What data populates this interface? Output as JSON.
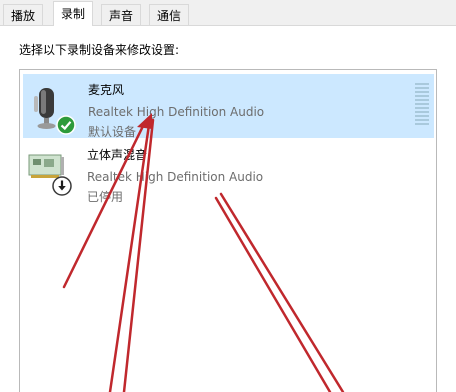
{
  "tabs": [
    {
      "label": "播放",
      "active": false
    },
    {
      "label": "录制",
      "active": true
    },
    {
      "label": "声音",
      "active": false
    },
    {
      "label": "通信",
      "active": false
    }
  ],
  "prompt": "选择以下录制设备来修改设置:",
  "devices": [
    {
      "name": "麦克风",
      "description": "Realtek High Definition Audio",
      "status": "默认设备",
      "selected": true,
      "icon": "microphone-icon",
      "badge": "default-check-badge"
    },
    {
      "name": "立体声混音",
      "description": "Realtek High Definition Audio",
      "status": "已停用",
      "selected": false,
      "icon": "sound-card-icon",
      "badge": "disabled-down-badge"
    }
  ],
  "colors": {
    "selection": "#cce8ff",
    "annotation_arrow": "#c0282d",
    "default_badge": "#2e9b3b"
  }
}
